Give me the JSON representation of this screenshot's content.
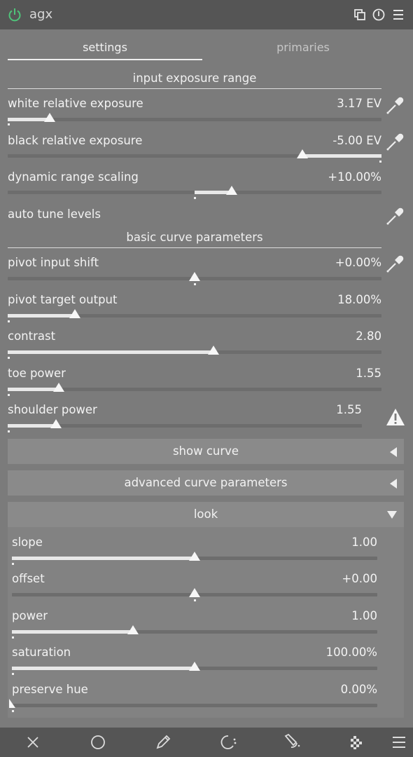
{
  "module": {
    "title": "agx",
    "header_icons": [
      "power-icon",
      "multi-instance-icon",
      "reset-icon",
      "presets-icon"
    ]
  },
  "tabs": [
    {
      "label": "settings",
      "active": true
    },
    {
      "label": "primaries",
      "active": false
    }
  ],
  "sections": {
    "input_exposure_range": "input exposure range",
    "basic_curve_parameters": "basic curve parameters"
  },
  "sliders": {
    "white_relative_exposure": {
      "label": "white relative exposure",
      "value": "3.17 EV",
      "level": 0.11
    },
    "black_relative_exposure": {
      "label": "black relative exposure",
      "value": "-5.00 EV",
      "level": 0.8
    },
    "dynamic_range_scaling": {
      "label": "dynamic range scaling",
      "value": "+10.00%",
      "level": 0.6
    },
    "pivot_input_shift": {
      "label": "pivot input shift",
      "value": "+0.00%",
      "level": 0.5
    },
    "pivot_target_output": {
      "label": "pivot target output",
      "value": "18.00%",
      "level": 0.18
    },
    "contrast": {
      "label": "contrast",
      "value": "2.80",
      "level": 0.55
    },
    "toe_power": {
      "label": "toe power",
      "value": "1.55",
      "level": 0.14
    },
    "shoulder_power": {
      "label": "shoulder power",
      "value": "1.55",
      "level": 0.14
    }
  },
  "auto_tune_levels": {
    "label": "auto tune levels"
  },
  "collapsibles": {
    "show_curve": "show curve",
    "advanced_curve_parameters": "advanced curve parameters",
    "look": "look"
  },
  "look": {
    "slope": {
      "label": "slope",
      "value": "1.00",
      "level": 0.5
    },
    "offset": {
      "label": "offset",
      "value": "+0.00",
      "level": 0.5
    },
    "power": {
      "label": "power",
      "value": "1.00",
      "level": 0.33
    },
    "saturation": {
      "label": "saturation",
      "value": "100.00%",
      "level": 0.5
    },
    "preserve_hue": {
      "label": "preserve hue",
      "value": "0.00%",
      "level": 0.0
    }
  },
  "bottom_toolbar": [
    "close-icon",
    "circle-mask-icon",
    "pencil-icon",
    "parametric-mask-icon",
    "drawn-parametric-icon",
    "raster-mask-icon",
    "menu-icon"
  ],
  "colors": {
    "panel_bg": "#7b7b7b",
    "header_bg": "#555555",
    "power_accent": "#4fc47a"
  }
}
